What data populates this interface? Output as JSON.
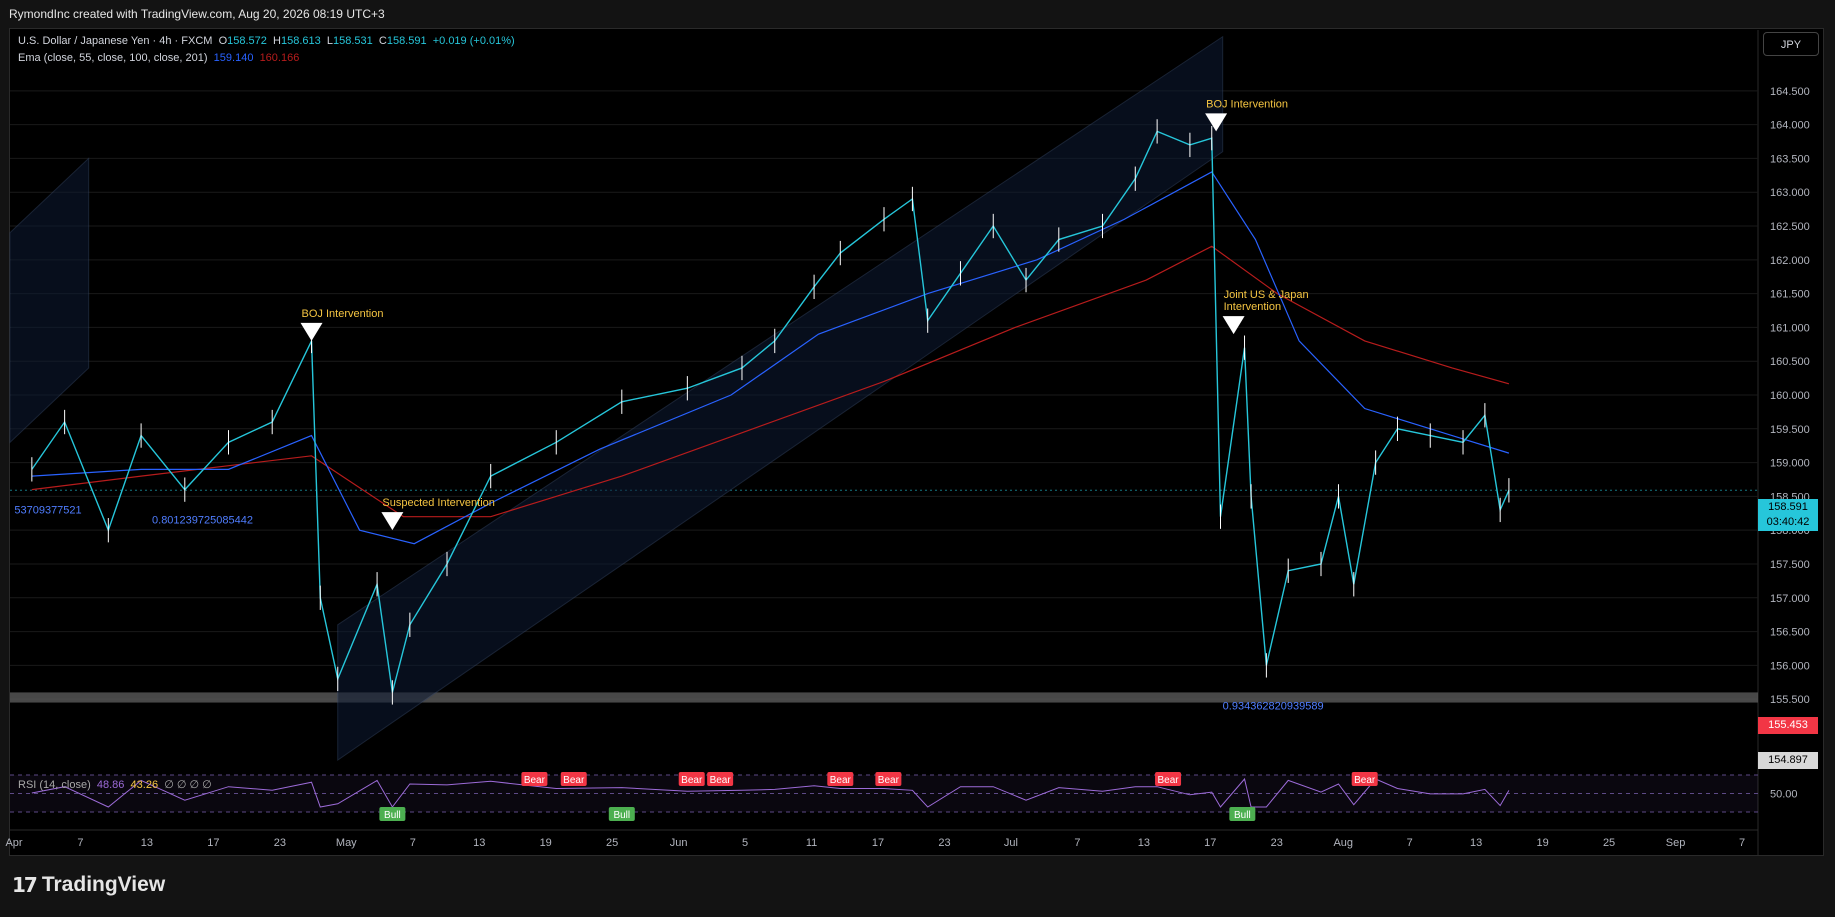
{
  "header": {
    "credit": "RymondInc created with TradingView.com, Aug 20, 2026 08:19 UTC+3"
  },
  "legend": {
    "symbol": "U.S. Dollar / Japanese Yen · 4h · FXCM",
    "o_label": "O",
    "o": "158.572",
    "h_label": "H",
    "h": "158.613",
    "l_label": "L",
    "l": "158.531",
    "c_label": "C",
    "c": "158.591",
    "change": "+0.019 (+0.01%)",
    "ema_label": "Ema (close, 55, close, 100, close, 201)",
    "ema1": "159.140",
    "ema2": "160.166"
  },
  "currency_button": "JPY",
  "rsi_legend": {
    "label": "RSI (14, close)",
    "v1": "48.86",
    "v2": "43.26",
    "rest": "∅ ∅ ∅ ∅"
  },
  "price_tags": {
    "last": "158.591",
    "countdown": "03:40:42",
    "red": "155.453",
    "gray": "154.897",
    "rsi_scale": "50.00"
  },
  "footer": {
    "logo_text": "TradingView"
  },
  "colors": {
    "background": "#000000",
    "candle": "#26c6da",
    "wick": "#ffffff",
    "ema1": "#2962ff",
    "ema2": "#b71c1c",
    "annotation": "#f5c542",
    "bear": "#f23645",
    "bull": "#4caf50"
  },
  "chart_data": {
    "type": "candlestick",
    "symbol": "USD/JPY",
    "timeframe": "4h",
    "ylim": [
      154.6,
      165.4
    ],
    "y_ticks": [
      "164.500",
      "164.000",
      "163.500",
      "163.000",
      "162.500",
      "162.000",
      "161.500",
      "161.000",
      "160.500",
      "160.000",
      "159.500",
      "159.000",
      "158.500",
      "158.000",
      "157.500",
      "157.000",
      "156.500",
      "156.000",
      "155.500"
    ],
    "x_ticks": [
      "Apr",
      "7",
      "13",
      "17",
      "23",
      "May",
      "7",
      "13",
      "19",
      "25",
      "Jun",
      "5",
      "11",
      "17",
      "23",
      "Jul",
      "7",
      "13",
      "17",
      "23",
      "Aug",
      "7",
      "13",
      "19",
      "25",
      "Sep",
      "7"
    ],
    "price_path": [
      {
        "x": 1.0,
        "y": 158.9
      },
      {
        "x": 2.5,
        "y": 159.6
      },
      {
        "x": 4.5,
        "y": 158.0
      },
      {
        "x": 6.0,
        "y": 159.4
      },
      {
        "x": 8.0,
        "y": 158.6
      },
      {
        "x": 10.0,
        "y": 159.3
      },
      {
        "x": 12.0,
        "y": 159.6
      },
      {
        "x": 13.8,
        "y": 160.8
      },
      {
        "x": 14.2,
        "y": 157.0
      },
      {
        "x": 15.0,
        "y": 155.8
      },
      {
        "x": 16.8,
        "y": 157.2
      },
      {
        "x": 17.5,
        "y": 155.6
      },
      {
        "x": 18.3,
        "y": 156.6
      },
      {
        "x": 20.0,
        "y": 157.5
      },
      {
        "x": 22.0,
        "y": 158.8
      },
      {
        "x": 25.0,
        "y": 159.3
      },
      {
        "x": 28.0,
        "y": 159.9
      },
      {
        "x": 31.0,
        "y": 160.1
      },
      {
        "x": 33.5,
        "y": 160.4
      },
      {
        "x": 35.0,
        "y": 160.8
      },
      {
        "x": 36.8,
        "y": 161.6
      },
      {
        "x": 38.0,
        "y": 162.1
      },
      {
        "x": 40.0,
        "y": 162.6
      },
      {
        "x": 41.3,
        "y": 162.9
      },
      {
        "x": 42.0,
        "y": 161.1
      },
      {
        "x": 43.5,
        "y": 161.8
      },
      {
        "x": 45.0,
        "y": 162.5
      },
      {
        "x": 46.5,
        "y": 161.7
      },
      {
        "x": 48.0,
        "y": 162.3
      },
      {
        "x": 50.0,
        "y": 162.5
      },
      {
        "x": 51.5,
        "y": 163.2
      },
      {
        "x": 52.5,
        "y": 163.9
      },
      {
        "x": 54.0,
        "y": 163.7
      },
      {
        "x": 55.0,
        "y": 163.8
      },
      {
        "x": 55.4,
        "y": 158.2
      },
      {
        "x": 56.5,
        "y": 160.7
      },
      {
        "x": 56.8,
        "y": 158.5
      },
      {
        "x": 57.5,
        "y": 156.0
      },
      {
        "x": 58.5,
        "y": 157.4
      },
      {
        "x": 60.0,
        "y": 157.5
      },
      {
        "x": 60.8,
        "y": 158.5
      },
      {
        "x": 61.5,
        "y": 157.2
      },
      {
        "x": 62.5,
        "y": 159.0
      },
      {
        "x": 63.5,
        "y": 159.5
      },
      {
        "x": 65.0,
        "y": 159.4
      },
      {
        "x": 66.5,
        "y": 159.3
      },
      {
        "x": 67.5,
        "y": 159.7
      },
      {
        "x": 68.2,
        "y": 158.3
      },
      {
        "x": 68.6,
        "y": 158.59
      }
    ],
    "ema_55": [
      {
        "x": 1.0,
        "y": 158.8
      },
      {
        "x": 6.0,
        "y": 158.9
      },
      {
        "x": 10.0,
        "y": 158.9
      },
      {
        "x": 13.8,
        "y": 159.4
      },
      {
        "x": 16.0,
        "y": 158.0
      },
      {
        "x": 18.5,
        "y": 157.8
      },
      {
        "x": 22.0,
        "y": 158.4
      },
      {
        "x": 27.0,
        "y": 159.2
      },
      {
        "x": 33.0,
        "y": 160.0
      },
      {
        "x": 37.0,
        "y": 160.9
      },
      {
        "x": 42.0,
        "y": 161.5
      },
      {
        "x": 47.0,
        "y": 162.0
      },
      {
        "x": 51.0,
        "y": 162.6
      },
      {
        "x": 55.0,
        "y": 163.3
      },
      {
        "x": 57.0,
        "y": 162.3
      },
      {
        "x": 59.0,
        "y": 160.8
      },
      {
        "x": 62.0,
        "y": 159.8
      },
      {
        "x": 66.0,
        "y": 159.4
      },
      {
        "x": 68.6,
        "y": 159.14
      }
    ],
    "ema_100": [
      {
        "x": 1.0,
        "y": 158.6
      },
      {
        "x": 6.0,
        "y": 158.8
      },
      {
        "x": 13.8,
        "y": 159.1
      },
      {
        "x": 18.0,
        "y": 158.2
      },
      {
        "x": 22.0,
        "y": 158.2
      },
      {
        "x": 28.0,
        "y": 158.8
      },
      {
        "x": 34.0,
        "y": 159.5
      },
      {
        "x": 40.0,
        "y": 160.2
      },
      {
        "x": 46.0,
        "y": 161.0
      },
      {
        "x": 52.0,
        "y": 161.7
      },
      {
        "x": 55.0,
        "y": 162.2
      },
      {
        "x": 58.0,
        "y": 161.5
      },
      {
        "x": 62.0,
        "y": 160.8
      },
      {
        "x": 66.0,
        "y": 160.4
      },
      {
        "x": 68.6,
        "y": 160.166
      }
    ],
    "annotations": [
      {
        "text": "BOJ Intervention",
        "x": 13.8,
        "y": 160.8
      },
      {
        "text": "Suspected Intervention",
        "x": 17.5,
        "y": 158.0
      },
      {
        "text": "BOJ Intervention",
        "x": 55.2,
        "y": 163.9
      },
      {
        "text": "Joint US & Japan\nIntervention",
        "x": 56.0,
        "y": 160.9
      }
    ],
    "fib_labels": [
      {
        "text": "53709377521",
        "x": 0.2,
        "y": 158.25
      },
      {
        "text": "0.801239725085442",
        "x": 6.5,
        "y": 158.1
      },
      {
        "text": "0.934362820939589",
        "x": 55.5,
        "y": 155.35
      }
    ],
    "rsi_signals": [
      {
        "text": "Bull",
        "x": 17.5,
        "kind": "bull"
      },
      {
        "text": "Bear",
        "x": 24.0,
        "kind": "bear"
      },
      {
        "text": "Bear",
        "x": 25.8,
        "kind": "bear"
      },
      {
        "text": "Bull",
        "x": 28.0,
        "kind": "bull"
      },
      {
        "text": "Bear",
        "x": 31.2,
        "kind": "bear"
      },
      {
        "text": "Bear",
        "x": 32.5,
        "kind": "bear"
      },
      {
        "text": "Bear",
        "x": 38.0,
        "kind": "bear"
      },
      {
        "text": "Bear",
        "x": 40.2,
        "kind": "bear"
      },
      {
        "text": "Bear",
        "x": 53.0,
        "kind": "bear"
      },
      {
        "text": "Bull",
        "x": 56.4,
        "kind": "bull"
      },
      {
        "text": "Bear",
        "x": 62.0,
        "kind": "bear"
      }
    ]
  }
}
